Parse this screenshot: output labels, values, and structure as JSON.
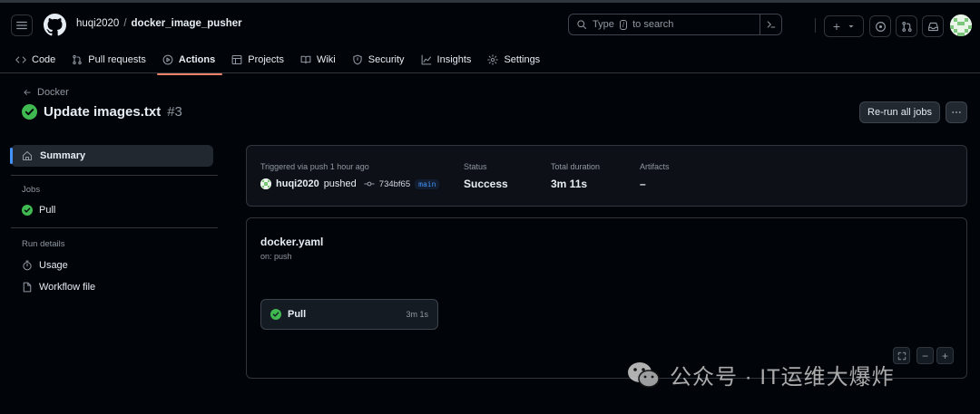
{
  "header": {
    "owner": "huqi2020",
    "separator": "/",
    "repo": "docker_image_pusher",
    "search_before": "Type",
    "search_key": "/",
    "search_after": "to search",
    "new_label": "+"
  },
  "tabs": [
    {
      "label": "Code",
      "icon": "code-icon"
    },
    {
      "label": "Pull requests",
      "icon": "pull-request-icon"
    },
    {
      "label": "Actions",
      "icon": "play-icon",
      "active": true
    },
    {
      "label": "Projects",
      "icon": "table-icon"
    },
    {
      "label": "Wiki",
      "icon": "book-icon"
    },
    {
      "label": "Security",
      "icon": "shield-icon"
    },
    {
      "label": "Insights",
      "icon": "graph-icon"
    },
    {
      "label": "Settings",
      "icon": "gear-icon"
    }
  ],
  "run": {
    "back_label": "Docker",
    "title": "Update images.txt",
    "number": "#3",
    "rerun_label": "Re-run all jobs"
  },
  "sidebar": {
    "summary_label": "Summary",
    "jobs_heading": "Jobs",
    "jobs": [
      {
        "label": "Pull"
      }
    ],
    "details_heading": "Run details",
    "details": [
      {
        "label": "Usage",
        "icon": "stopwatch-icon"
      },
      {
        "label": "Workflow file",
        "icon": "file-icon"
      }
    ]
  },
  "summary": {
    "trigger_label": "Triggered via push 1 hour ago",
    "user": "huqi2020",
    "action": "pushed",
    "sha": "734bf65",
    "branch": "main",
    "status_label": "Status",
    "status_value": "Success",
    "duration_label": "Total duration",
    "duration_value": "3m 11s",
    "artifacts_label": "Artifacts",
    "artifacts_value": "–"
  },
  "workflow": {
    "file": "docker.yaml",
    "on": "on: push",
    "job_name": "Pull",
    "job_time": "3m 1s",
    "zoom_out": "−",
    "zoom_in": "+"
  },
  "watermark": {
    "text": "公众号 · IT运维大爆炸"
  },
  "colors": {
    "success": "#3fb950",
    "accent_underline": "#f78166",
    "link": "#4493f8"
  }
}
